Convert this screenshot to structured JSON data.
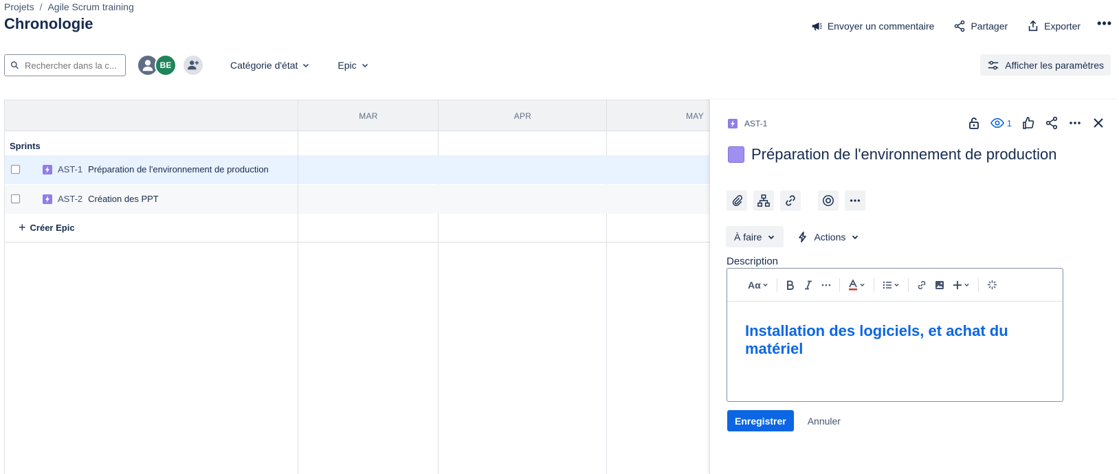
{
  "breadcrumb": {
    "projects": "Projets",
    "separator": "/",
    "project": "Agile Scrum training"
  },
  "page": {
    "title": "Chronologie"
  },
  "top_actions": {
    "feedback": "Envoyer un commentaire",
    "share": "Partager",
    "export": "Exporter",
    "more": "•••"
  },
  "filters": {
    "search_placeholder": "Rechercher dans la c...",
    "avatar_initials": "BE",
    "status_category": "Catégorie d'état",
    "epic": "Epic",
    "settings": "Afficher les paramètres"
  },
  "timeline": {
    "months": [
      "MAR",
      "APR",
      "MAY"
    ],
    "sprints_label": "Sprints",
    "epics": [
      {
        "key": "AST-1",
        "summary": "Préparation de l'environnement de production"
      },
      {
        "key": "AST-2",
        "summary": "Création des PPT"
      }
    ],
    "create_epic": "Créer Epic"
  },
  "panel": {
    "issue_key": "AST-1",
    "watch_count": "1",
    "title": "Préparation de l'environnement de production",
    "status": "À faire",
    "actions": "Actions",
    "description_label": "Description",
    "toolbar": {
      "text_style": "Aα"
    },
    "description_heading": "Installation des logiciels, et achat du matériel",
    "save": "Enregistrer",
    "cancel": "Annuler"
  },
  "colors": {
    "brand_blue": "#0c66e4",
    "epic_purple": "#8f7ee7",
    "avatar_green": "#1f845a"
  }
}
